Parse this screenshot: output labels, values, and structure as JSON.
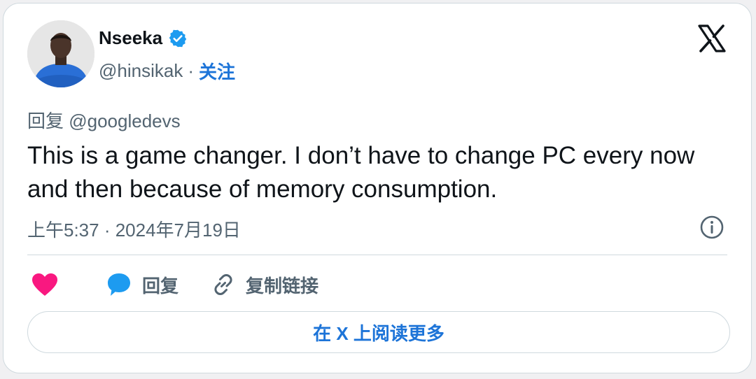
{
  "author": {
    "display_name": "Nseeka",
    "handle": "@hinsikak",
    "separator": "·",
    "follow_label": "关注"
  },
  "tweet": {
    "reply_to": "回复 @googledevs",
    "text": "This is a game changer. I don’t have to change PC every now and then because of memory consumption.",
    "timestamp": "上午5:37 · 2024年7月19日"
  },
  "actions": {
    "reply_label": "回复",
    "copy_link_label": "复制链接"
  },
  "read_more_label": "在 X 上阅读更多",
  "colors": {
    "accent": "#1d74d8",
    "like": "#f91880",
    "reply_bubble": "#1d9bf0",
    "muted_text": "#536471",
    "verified": "#1d9bf0"
  },
  "icons": {
    "verified": "verified-badge-icon",
    "platform": "x-logo-icon",
    "info": "info-icon",
    "like": "heart-icon",
    "reply": "speech-bubble-icon",
    "copy_link": "link-icon"
  }
}
